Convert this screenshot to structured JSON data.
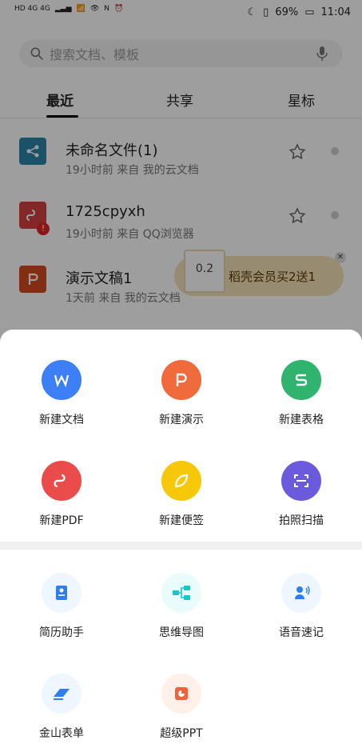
{
  "status": {
    "left": "HD 4G 4G",
    "battery": "69%",
    "time": "11:04"
  },
  "search": {
    "placeholder": "搜索文档、模板"
  },
  "tabs": [
    {
      "label": "最近"
    },
    {
      "label": "共享"
    },
    {
      "label": "星标"
    }
  ],
  "files": [
    {
      "title": "未命名文件(1)",
      "meta": "19小时前   来自 我的云文档"
    },
    {
      "title": "1725cpyxh",
      "meta": "19小时前   来自 QQ浏览器"
    },
    {
      "title": "演示文稿1",
      "meta": "1天前   来自 我的云文档"
    }
  ],
  "promo": {
    "badge": "0.2",
    "text": "稻壳会员买2送1",
    "close": "✕"
  },
  "sheet": {
    "create": [
      {
        "label": "新建文档",
        "color": "#3d7ff6"
      },
      {
        "label": "新建演示",
        "color": "#f06a3b"
      },
      {
        "label": "新建表格",
        "color": "#2fb36d"
      },
      {
        "label": "新建PDF",
        "color": "#ea4b4b"
      },
      {
        "label": "新建便签",
        "color": "#f7c70a"
      },
      {
        "label": "拍照扫描",
        "color": "#6b5bdc"
      }
    ],
    "tools": [
      {
        "label": "简历助手"
      },
      {
        "label": "思维导图"
      },
      {
        "label": "语音速记"
      },
      {
        "label": "金山表单"
      },
      {
        "label": "超级PPT"
      }
    ]
  }
}
